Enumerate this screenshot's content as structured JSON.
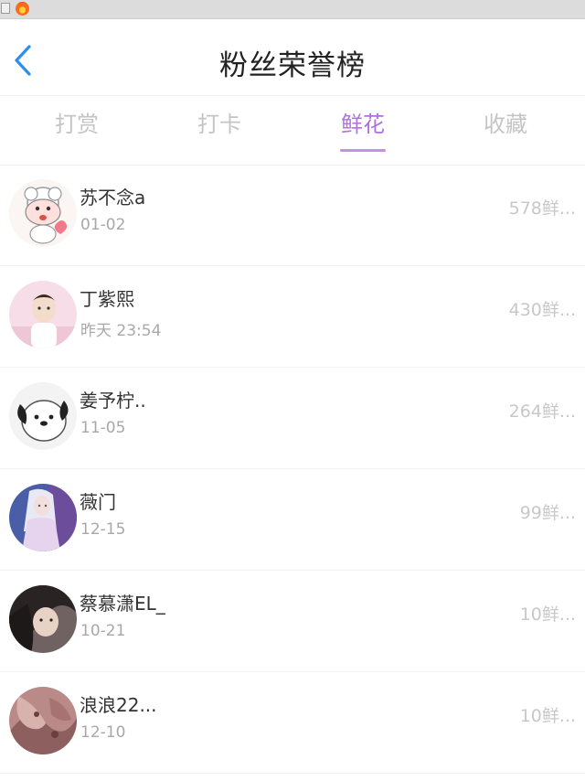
{
  "header": {
    "title": "粉丝荣誉榜"
  },
  "tabs": [
    {
      "label": "打赏",
      "active": false
    },
    {
      "label": "打卡",
      "active": false
    },
    {
      "label": "鲜花",
      "active": true
    },
    {
      "label": "收藏",
      "active": false
    }
  ],
  "fans": [
    {
      "name": "苏不念a",
      "time": "01-02",
      "count": "578鲜..."
    },
    {
      "name": "丁紫熙",
      "time": "昨天 23:54",
      "count": "430鲜..."
    },
    {
      "name": "姜予柠..",
      "time": "11-05",
      "count": "264鲜..."
    },
    {
      "name": "薇门",
      "time": "12-15",
      "count": "99鲜..."
    },
    {
      "name": "蔡慕潇EL_",
      "time": "10-21",
      "count": "10鲜..."
    },
    {
      "name": "浪浪22...",
      "time": "12-10",
      "count": "10鲜..."
    }
  ],
  "colors": {
    "accent": "#c48ee9",
    "back_arrow": "#2e8ef0"
  },
  "icons": {
    "back": "chevron-left-icon",
    "app": "fire-icon"
  }
}
